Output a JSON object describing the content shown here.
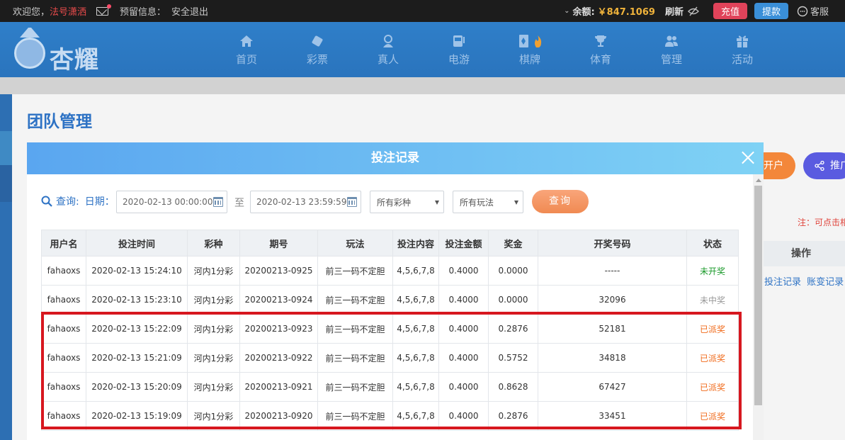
{
  "topbar": {
    "welcome": "欢迎您，",
    "username": "法号潇洒",
    "notice_label": "预留信息：",
    "logout": "安全退出",
    "balance_label": "余额:",
    "balance_value": "￥847.1069",
    "refresh": "刷新",
    "recharge": "充值",
    "withdraw": "提款",
    "service": "客服"
  },
  "header": {
    "logo_text": "杏耀",
    "nav": [
      {
        "label": "首页",
        "icon": "home-icon"
      },
      {
        "label": "彩票",
        "icon": "lottery-icon"
      },
      {
        "label": "真人",
        "icon": "live-dealer-icon"
      },
      {
        "label": "电游",
        "icon": "slot-game-icon"
      },
      {
        "label": "棋牌",
        "icon": "chess-card-icon"
      },
      {
        "label": "体育",
        "icon": "trophy-icon"
      },
      {
        "label": "管理",
        "icon": "users-icon"
      },
      {
        "label": "活动",
        "icon": "gift-icon"
      }
    ]
  },
  "background_page": {
    "title": "团队管理",
    "btn_open_account": "开户",
    "btn_promote": "推广",
    "note": "注：可点击相",
    "col_operation": "操作",
    "link_bet_record": "投注记录",
    "link_account_change": "账变记录"
  },
  "modal": {
    "title": "投注记录",
    "filter": {
      "query_label": "查询:",
      "date_label": "日期：",
      "date_from": "2020-02-13 00:00:00",
      "to_label": "至",
      "date_to": "2020-02-13 23:59:59",
      "lottery_select": "所有彩种",
      "play_select": "所有玩法",
      "query_button": "查询"
    },
    "columns": [
      "用户名",
      "投注时间",
      "彩种",
      "期号",
      "玩法",
      "投注内容",
      "投注金额",
      "奖金",
      "开奖号码",
      "状态"
    ],
    "rows": [
      {
        "user": "fahaoxs",
        "time": "2020-02-13 15:24:10",
        "lottery": "河内1分彩",
        "issue": "20200213-0925",
        "play": "前三一码不定胆",
        "content": "4,5,6,7,8",
        "amount": "0.4000",
        "prize": "0.0000",
        "numbers": "-----",
        "status": "未开奖",
        "status_color": "#1a9a2a"
      },
      {
        "user": "fahaoxs",
        "time": "2020-02-13 15:23:10",
        "lottery": "河内1分彩",
        "issue": "20200213-0924",
        "play": "前三一码不定胆",
        "content": "4,5,6,7,8",
        "amount": "0.4000",
        "prize": "0.0000",
        "numbers": "32096",
        "status": "未中奖",
        "status_color": "#999999"
      },
      {
        "user": "fahaoxs",
        "time": "2020-02-13 15:22:09",
        "lottery": "河内1分彩",
        "issue": "20200213-0923",
        "play": "前三一码不定胆",
        "content": "4,5,6,7,8",
        "amount": "0.4000",
        "prize": "0.2876",
        "numbers": "52181",
        "status": "已派奖",
        "status_color": "#f06a1a"
      },
      {
        "user": "fahaoxs",
        "time": "2020-02-13 15:21:09",
        "lottery": "河内1分彩",
        "issue": "20200213-0922",
        "play": "前三一码不定胆",
        "content": "4,5,6,7,8",
        "amount": "0.4000",
        "prize": "0.5752",
        "numbers": "34818",
        "status": "已派奖",
        "status_color": "#f06a1a"
      },
      {
        "user": "fahaoxs",
        "time": "2020-02-13 15:20:09",
        "lottery": "河内1分彩",
        "issue": "20200213-0921",
        "play": "前三一码不定胆",
        "content": "4,5,6,7,8",
        "amount": "0.4000",
        "prize": "0.8628",
        "numbers": "67427",
        "status": "已派奖",
        "status_color": "#f06a1a"
      },
      {
        "user": "fahaoxs",
        "time": "2020-02-13 15:19:09",
        "lottery": "河内1分彩",
        "issue": "20200213-0920",
        "play": "前三一码不定胆",
        "content": "4,5,6,7,8",
        "amount": "0.4000",
        "prize": "0.2876",
        "numbers": "33451",
        "status": "已派奖",
        "status_color": "#f06a1a"
      }
    ]
  },
  "colors": {
    "accent_blue": "#2d72c4",
    "highlight_red": "#d7171f",
    "status_won": "#f06a1a",
    "status_pending": "#1a9a2a",
    "status_lost": "#999999"
  }
}
